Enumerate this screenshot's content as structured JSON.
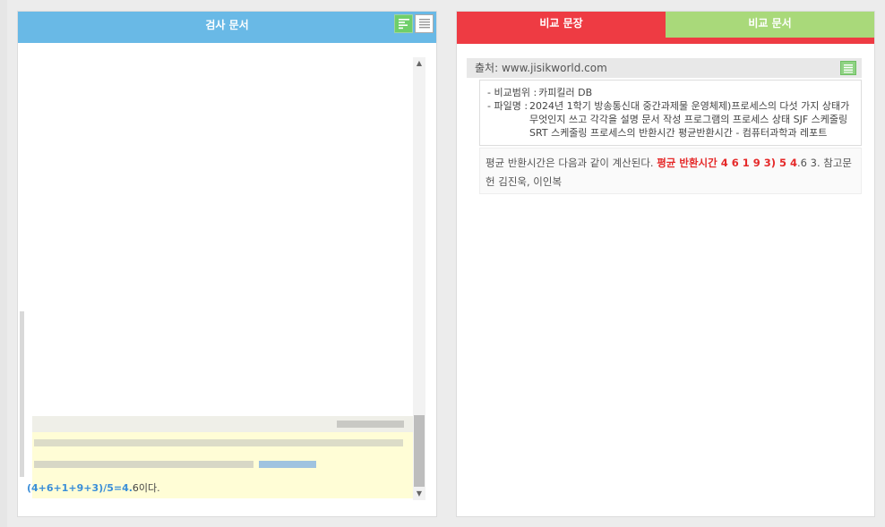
{
  "left_panel": {
    "title": "검사 문서",
    "result_equation": "(4+6+1+9+3)/5=4.",
    "result_tail": "6이다."
  },
  "right_panel": {
    "tabs": [
      {
        "label": "비교 문장",
        "active": true
      },
      {
        "label": "비교 문서",
        "active": false
      }
    ],
    "source_text": "출처: www.jisikworld.com",
    "meta": {
      "scope_key": "- 비교범위 :",
      "scope_val": "카피킬러 DB",
      "file_key": "- 파일명 :",
      "file_val": "2024년 1학기 방송통신대 중간과제물 운영체제)프로세스의 다섯 가지 상태가 무엇인지 쓰고 각각을 설명 문서 작성 프로그램의 프로세스 상태 SJF 스케줄링 SRT 스케줄링 프로세스의 반환시간 평균반환시간 - 컴퓨터과학과 레포트"
    },
    "sentence": {
      "before": "평균 반환시간은 다음과 같이 계산된다.",
      "highlight": "평균 반환시간 4 6 1 9 3) 5 4",
      "after": ".6 3. 참고문헌 김진욱, 이인복"
    }
  },
  "colors": {
    "left_header": "#69b9e6",
    "tab_active": "#ee3b43",
    "tab_inactive": "#a9d97a",
    "highlight_text": "#e52a2a",
    "snippet_bg": "#fffdd6"
  },
  "icons": [
    "text-align-icon",
    "list-icon",
    "list-icon",
    "scroll-up-icon",
    "scroll-down-icon"
  ]
}
